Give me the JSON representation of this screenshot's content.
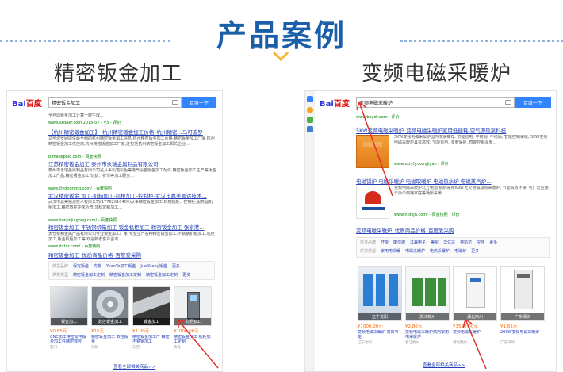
{
  "page": {
    "title": "产品案例",
    "left_subtitle": "精密钣金加工",
    "right_subtitle": "变频电磁采暖炉"
  },
  "colors": {
    "accent": "#1a5fa8",
    "baidu_blue": "#3385ff",
    "link": "#2440b3",
    "highlight": "#c00000",
    "price": "#ff6600",
    "arrow": "#e0322b"
  },
  "left": {
    "logo_a": "Bai",
    "logo_b": "百度",
    "query": "精密钣金加工",
    "search_button": "百度一下",
    "top_snippet_1": "全自动钣金加工计算一键生成...",
    "top_snippet_2": "www.sxdaer.com 2015-07 - V3 - 评价",
    "results": [
      {
        "title": "【杭州精密钣金加工】_杭州精密钣金加工价格_杭州精密...马可波罗",
        "desc": "马可波罗网提供最全面的杭州精密钣金加工信息,杭州精密钣金加工价格,精密钣金加工厂家,杭州精密钣金加工供应商,杭州精密钣金加工厂家,还包括杭州精密钣金加工相关企业...",
        "url": "b.makepolo.com - 百度快照"
      },
      {
        "title": "江苏精密钣金加工 泰州市永瑞金属制品有限公司",
        "desc": "泰州市永瑞金属制品有限公司是从事机箱机柜等电气设备钣金加工配件,精密钣金加工生产等钣金加工产品,精密钣金加工,切割、折弯等加工服务...",
        "url": "www.ttyongrong.com/ - 百度快照"
      },
      {
        "title": "武汉精密钣金 加工-机箱加工-机柜加工-控制柜-武汉市嘉美顺达技术...",
        "desc": "武汉市嘉美顺达技术有限公司(17762610409)从事精密钣金加工,机箱机柜、控制柜,服务器机柜加工,精密数控冲床折弯,非标定制加工...",
        "url": "www.bonjinjiagong.com/ - 百度快照"
      },
      {
        "title": "精密钣金加工 不锈钢机箱加工 钣金机柜加工 精密钣金加工 张家港...",
        "desc": "太仓泰和金属产品有限公司专业钣金加工厂家,专业生产各种精密钣金加工,不锈钢机箱加工,机柜加工,钣金机柜加工等,欢迎新老客户咨询...",
        "url": "www.jtxtar.com/ - 百度快照"
      },
      {
        "title": "精密钣金加工_优质商品价格_百度爱采购",
        "desc": "",
        "url": ""
      }
    ],
    "filters": [
      {
        "label": "供货品牌",
        "items": [
          "保定钣金",
          "方物",
          "YuanYe加工钣金",
          "JueSheng钣金"
        ],
        "more": "更多"
      },
      {
        "label": "供货类型",
        "items": [
          "精密钣金加工定制",
          "精密钣金加工定制",
          "精密钣金加工定制"
        ],
        "more": "更多"
      }
    ],
    "products": [
      {
        "caption": "钣金加工",
        "price": "¥0.85元",
        "name": "CNC加工精密零件钣金加工件精密数控",
        "source": "厦门"
      },
      {
        "caption": "数控钣金加工",
        "price": "¥15元",
        "name": "精密钣金加工 数控钣金",
        "source": "深圳"
      },
      {
        "caption": "钣金加工",
        "price": "¥1.00元",
        "name": "精密钣金加工厂 精密不锈钢加工",
        "source": "东莞"
      },
      {
        "caption": "机柜加工",
        "price": "¥1000.00元",
        "name": "精密钣金加工 机柜加工定制",
        "source": "青岛"
      }
    ],
    "more_link": "查看全部相关商品>>"
  },
  "right": {
    "logo_a": "Bai",
    "logo_b": "百度",
    "query": "变频电磁采暖炉",
    "search_button": "百度一下",
    "top_url": "www.baydr.com - 评价",
    "results": [
      {
        "title": "5KW变频电磁采暖炉_变频电磁采暖炉家用低能耗-空气源热泵科技",
        "desc": "5KW变频电磁采暖炉国内专家推荐, 节能省电, 不锈钢, 不结垢, 智能控制采暖, 5KW变频电磁采暖炉具有高效, 节能省电, 多重保护, 智能控制温度...",
        "url": "www.sxtyfy.com/jiyan - 评价"
      },
      {
        "title": "电磁锅炉 电磁采暖炉 电磁取暖炉 电磁热水炉 电磁蒸汽炉...",
        "desc": "变频电磁采暖炉北方电源 锅炉采用IGBT无火电磁加热采暖炉, 节能高效环保, 可广泛应用于办公商铺家庭等场所采暖...",
        "url": "www.hbtsjn.com/ - 百度快照 - 评价"
      },
      {
        "title": "变频电磁采暖炉_优质商品价格_百度爱采购",
        "desc": "",
        "url": ""
      }
    ],
    "filters": [
      {
        "label": "供货品牌",
        "items": [
          "旺能",
          "康尔德",
          "江森电子",
          "美星",
          "华亿达",
          "奥凯达",
          "宝佳"
        ],
        "more": "更多"
      },
      {
        "label": "供货类型",
        "items": [
          "家用电采暖",
          "电磁采暖炉",
          "电热采暖炉",
          "电磁炉"
        ],
        "more": "更多"
      }
    ],
    "products": [
      {
        "caption": "辽宁沈阳",
        "price": "¥1000.00元",
        "name": "变频电磁采暖炉 高效节能",
        "source": "辽宁沈阳"
      },
      {
        "caption": "浙江杭州",
        "price": "¥2.80元",
        "name": "变频电磁采暖炉商用家用电采暖炉",
        "source": "浙江杭州"
      },
      {
        "caption": "湖北荆州",
        "price": "¥3500.00元",
        "name": "变频电磁采暖炉",
        "source": "湖北荆州"
      },
      {
        "caption": "广东深圳",
        "price": "¥1.65万",
        "name": "20KW变频电磁采暖炉",
        "source": "广东深圳"
      }
    ],
    "more_link": "查看全部相关商品>>"
  }
}
